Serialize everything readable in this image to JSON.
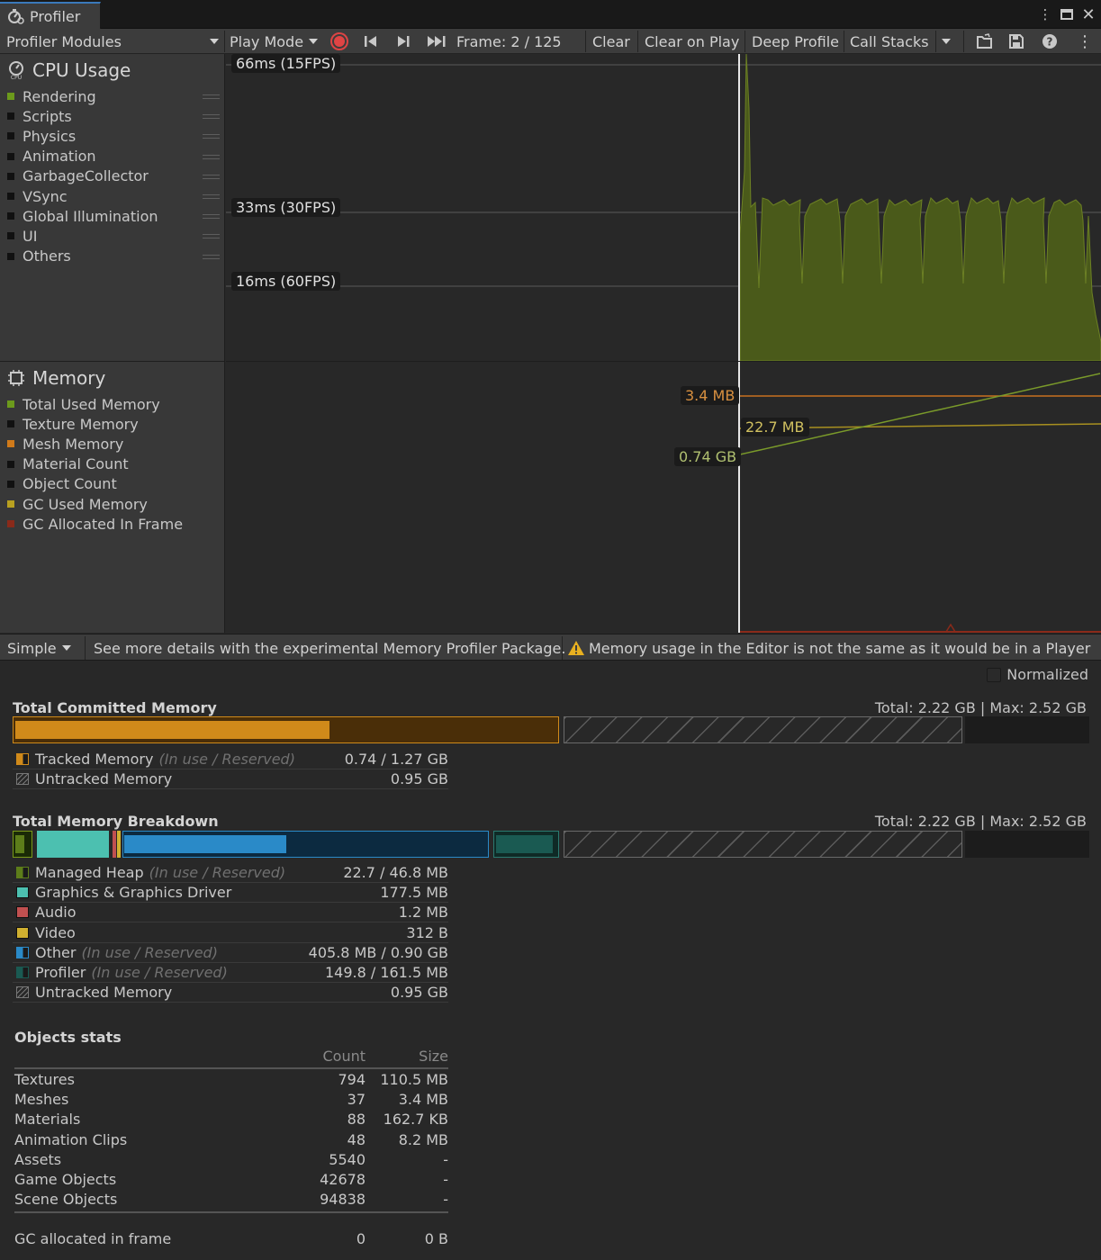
{
  "window": {
    "tab_title": "Profiler",
    "tab_icon": "profiler-icon"
  },
  "toolbar": {
    "modules_label": "Profiler Modules",
    "mode_label": "Play Mode",
    "frame_label": "Frame: 2 / 125",
    "clear_label": "Clear",
    "clear_on_play_label": "Clear on Play",
    "deep_profile_label": "Deep Profile",
    "call_stacks_label": "Call Stacks",
    "record_color": "#e04444"
  },
  "cpu": {
    "title": "CPU Usage",
    "items": [
      {
        "label": "Rendering",
        "color": "#6c9a1c"
      },
      {
        "label": "Scripts",
        "color": "#111111"
      },
      {
        "label": "Physics",
        "color": "#111111"
      },
      {
        "label": "Animation",
        "color": "#111111"
      },
      {
        "label": "GarbageCollector",
        "color": "#111111"
      },
      {
        "label": "VSync",
        "color": "#111111"
      },
      {
        "label": "Global Illumination",
        "color": "#111111"
      },
      {
        "label": "UI",
        "color": "#111111"
      },
      {
        "label": "Others",
        "color": "#111111"
      }
    ],
    "thresholds": [
      "66ms (15FPS)",
      "33ms (30FPS)",
      "16ms (60FPS)"
    ],
    "fill_color": "#4a5a1a"
  },
  "memory": {
    "title": "Memory",
    "items": [
      {
        "label": "Total Used Memory",
        "color": "#6c9a1c"
      },
      {
        "label": "Texture Memory",
        "color": "#111111"
      },
      {
        "label": "Mesh Memory",
        "color": "#d07a1a"
      },
      {
        "label": "Material Count",
        "color": "#111111"
      },
      {
        "label": "Object Count",
        "color": "#111111"
      },
      {
        "label": "GC Used Memory",
        "color": "#b8a020"
      },
      {
        "label": "GC Allocated In Frame",
        "color": "#8a2a1a"
      }
    ],
    "labels": {
      "mesh": "3.4 MB",
      "gc": "22.7 MB",
      "total": "0.74 GB"
    }
  },
  "details_bar": {
    "view_mode": "Simple",
    "package_hint": "See more details with the experimental Memory Profiler Package.",
    "warning": "Memory usage in the Editor is not the same as it would be in a Player"
  },
  "details": {
    "normalized_label": "Normalized",
    "committed": {
      "title": "Total Committed Memory",
      "total": "Total: 2.22 GB | Max: 2.52 GB",
      "rows": [
        {
          "label": "Tracked Memory",
          "sub": "(In use / Reserved)",
          "value": "0.74 / 1.27 GB",
          "color": "#d08a1a"
        },
        {
          "label": "Untracked Memory",
          "sub": "",
          "value": "0.95 GB",
          "color": "#3a3a3a"
        }
      ]
    },
    "breakdown": {
      "title": "Total Memory Breakdown",
      "total": "Total: 2.22 GB | Max: 2.52 GB",
      "rows": [
        {
          "label": "Managed Heap",
          "sub": "(In use / Reserved)",
          "value": "22.7 / 46.8 MB",
          "color": "#5d7d1a"
        },
        {
          "label": "Graphics & Graphics Driver",
          "sub": "",
          "value": "177.5 MB",
          "color": "#4cc0b0"
        },
        {
          "label": "Audio",
          "sub": "",
          "value": "1.2 MB",
          "color": "#c05050"
        },
        {
          "label": "Video",
          "sub": "",
          "value": "312 B",
          "color": "#d0b030"
        },
        {
          "label": "Other",
          "sub": "(In use / Reserved)",
          "value": "405.8 MB / 0.90 GB",
          "color": "#2a8ac8"
        },
        {
          "label": "Profiler",
          "sub": "(In use / Reserved)",
          "value": "149.8 / 161.5 MB",
          "color": "#1a5a52"
        },
        {
          "label": "Untracked Memory",
          "sub": "",
          "value": "0.95 GB",
          "color": "#3a3a3a"
        }
      ]
    },
    "objects": {
      "title": "Objects stats",
      "headers": {
        "count": "Count",
        "size": "Size"
      },
      "rows": [
        {
          "name": "Textures",
          "count": "794",
          "size": "110.5 MB"
        },
        {
          "name": "Meshes",
          "count": "37",
          "size": "3.4 MB"
        },
        {
          "name": "Materials",
          "count": "88",
          "size": "162.7 KB"
        },
        {
          "name": "Animation Clips",
          "count": "48",
          "size": "8.2 MB"
        },
        {
          "name": "Assets",
          "count": "5540",
          "size": "-"
        },
        {
          "name": "Game Objects",
          "count": "42678",
          "size": "-"
        },
        {
          "name": "Scene Objects",
          "count": "94838",
          "size": "-"
        }
      ],
      "gc_row": {
        "name": "GC allocated in frame",
        "count": "0",
        "size": "0 B"
      }
    }
  }
}
